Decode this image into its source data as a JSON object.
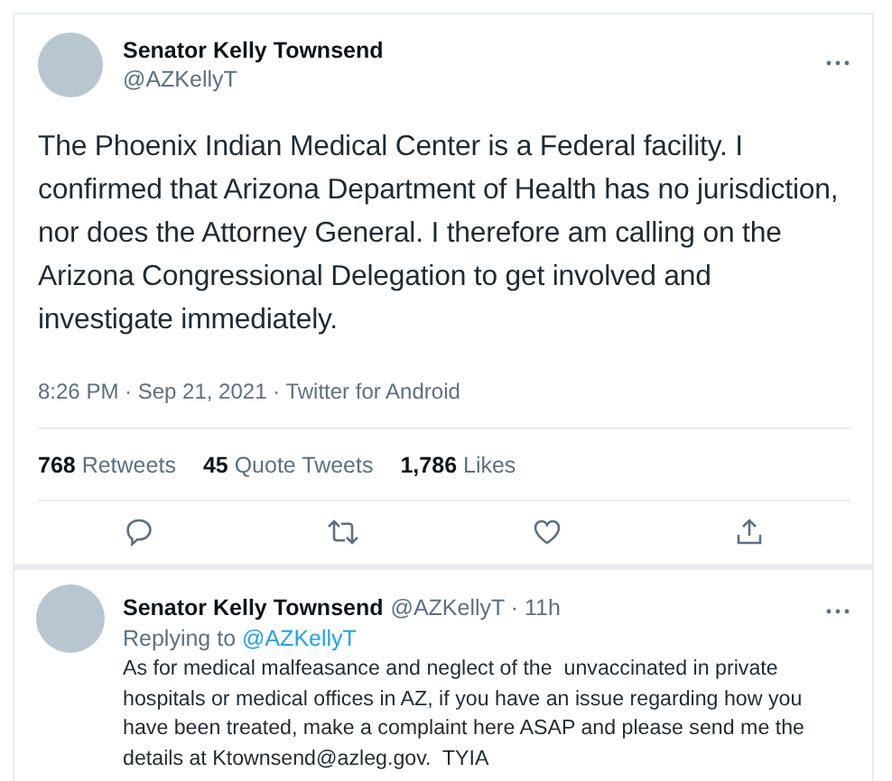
{
  "main_tweet": {
    "author_name": "Senator Kelly Townsend",
    "handle": "@AZKellyT",
    "text": "The Phoenix Indian Medical Center is a Federal facility. I confirmed that Arizona Department of Health has no jurisdiction, nor does the Attorney General. I therefore am calling on the Arizona Congressional Delegation to get involved and investigate immediately.",
    "timestamp": "8:26 PM · Sep 21, 2021 · Twitter for Android",
    "stats": [
      "**768** Retweets",
      "**45** Quote Tweets",
      "**1,786** Likes"
    ]
  },
  "reply": {
    "author_name": "Senator Kelly Townsend",
    "handle_time": "@AZKellyT · 11h",
    "replying_label": "Replying to",
    "replying_handle": "@AZKellyT",
    "text": "As for medical malfeasance and neglect of the  unvaccinated in private hospitals or medical offices in AZ, if you have an issue regarding how you have been treated, make a complaint here ASAP and please send me the details at Ktownsend@azleg.gov.  TYIA"
  }
}
